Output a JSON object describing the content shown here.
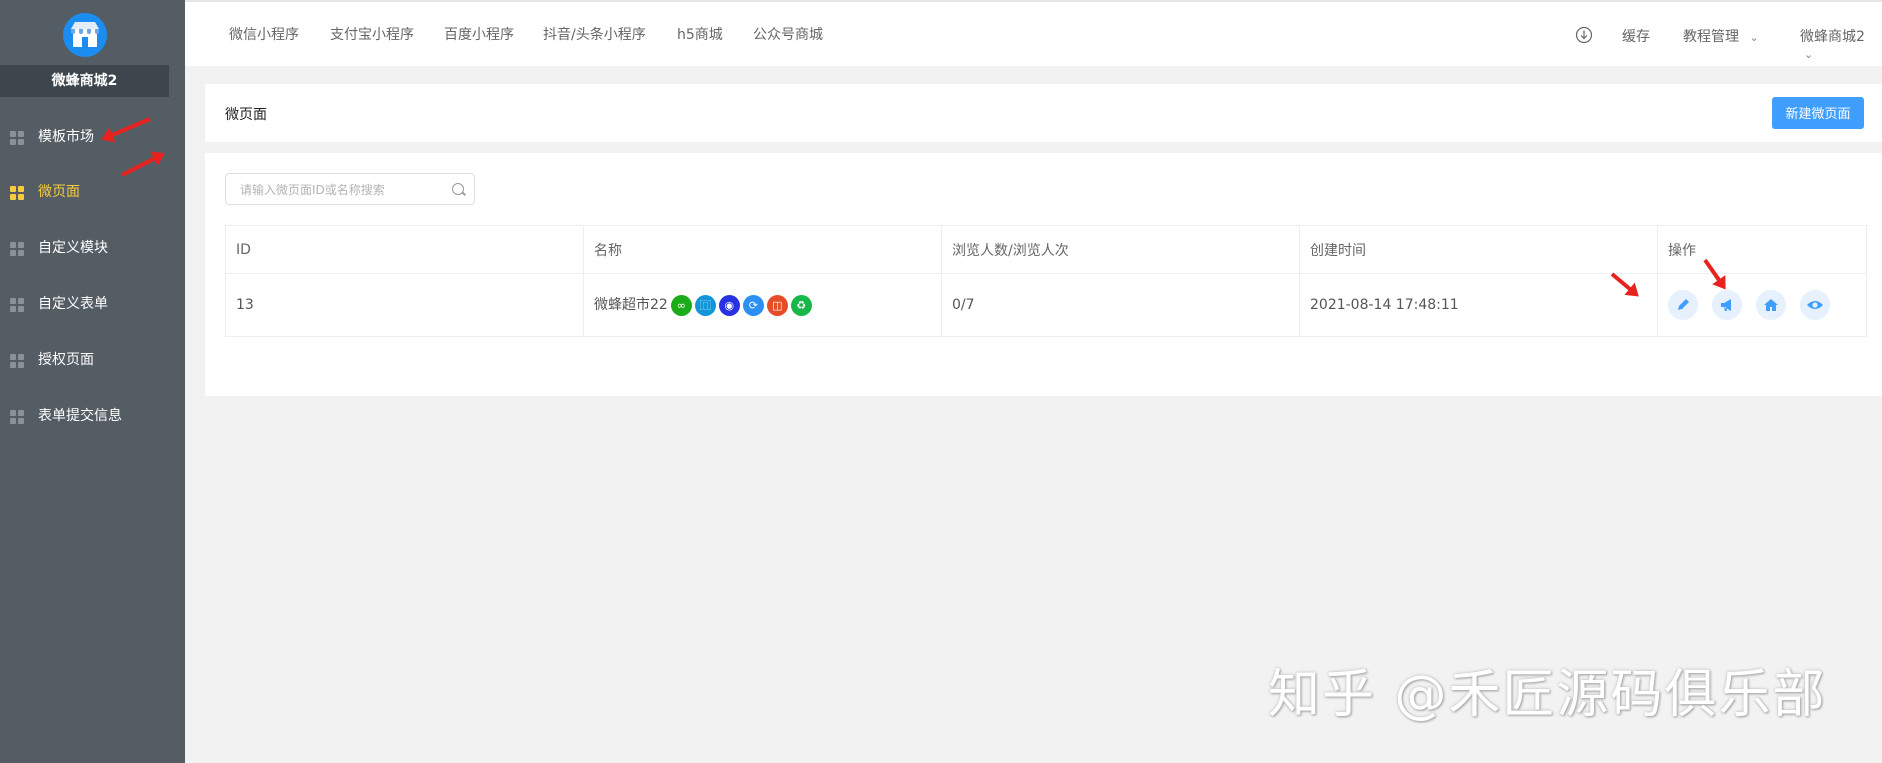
{
  "sidebar": {
    "shop_name": "微蜂商城2",
    "items": [
      {
        "label": "模板市场",
        "active": false
      },
      {
        "label": "微页面",
        "active": true
      },
      {
        "label": "自定义模块",
        "active": false
      },
      {
        "label": "自定义表单",
        "active": false
      },
      {
        "label": "授权页面",
        "active": false
      },
      {
        "label": "表单提交信息",
        "active": false
      }
    ]
  },
  "topbar": {
    "tabs": [
      "微信小程序",
      "支付宝小程序",
      "百度小程序",
      "抖音/头条小程序",
      "h5商城",
      "公众号商城"
    ],
    "cache": "缓存",
    "tutorial": "教程管理",
    "account": "微蜂商城2"
  },
  "page": {
    "title": "微页面",
    "new_button": "新建微页面",
    "search_placeholder": "请输入微页面ID或名称搜索"
  },
  "table": {
    "headers": [
      "ID",
      "名称",
      "浏览人数/浏览人次",
      "创建时间",
      "操作"
    ],
    "rows": [
      {
        "id": "13",
        "name": "微蜂超市22",
        "views": "0/7",
        "created": "2021-08-14 17:48:11"
      }
    ],
    "channel_icons": [
      {
        "name": "wechat-miniprogram-icon",
        "color": "#1aad19"
      },
      {
        "name": "alipay-icon",
        "color": "#1296db"
      },
      {
        "name": "baidu-icon",
        "color": "#2932e1"
      },
      {
        "name": "toutiao-icon",
        "color": "#2b8ff3"
      },
      {
        "name": "h5-icon",
        "color": "#e54d26"
      },
      {
        "name": "official-account-icon",
        "color": "#17b74a"
      }
    ],
    "operations": [
      "edit-icon",
      "promote-icon",
      "set-home-icon",
      "preview-icon"
    ]
  },
  "colors": {
    "sidebar_bg": "#545c64",
    "active": "#f4cc3d",
    "primary": "#409eff",
    "annotation_arrow": "#e8231f"
  },
  "watermark": "知乎 @禾匠源码俱乐部"
}
